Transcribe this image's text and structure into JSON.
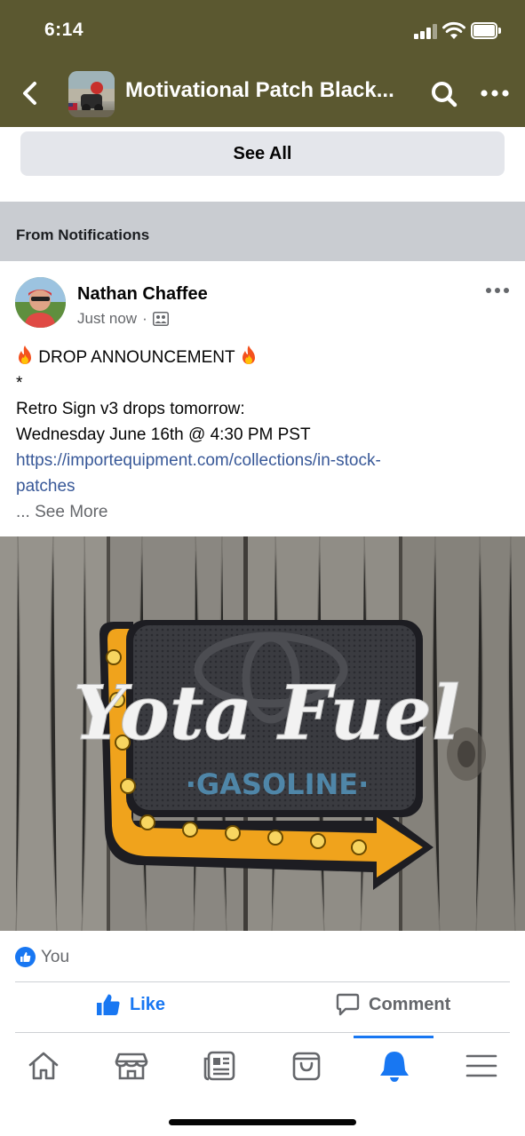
{
  "status_bar": {
    "time": "6:14"
  },
  "header": {
    "title": "Motivational Patch Black...",
    "back_icon": "chevron-left-icon",
    "search_icon": "search-icon",
    "more_icon": "more-horizontal-icon"
  },
  "see_all": {
    "label": "See All"
  },
  "section": {
    "label": "From Notifications"
  },
  "post": {
    "author": "Nathan Chaffee",
    "time": "Just now",
    "separator": "·",
    "audience_icon": "group-members-icon",
    "lines": {
      "headline": "DROP ANNOUNCEMENT",
      "asterisk": "*",
      "line1": "Retro Sign v3 drops tomorrow:",
      "line2": "Wednesday June 16th @ 4:30 PM PST",
      "link_part1": "https://importequipment.com/collections/in-stock-",
      "link_part2": "patches",
      "see_more": "... See More"
    },
    "image": {
      "patch_script": "Yota Fuel",
      "patch_sub": "·GASOLINE·"
    },
    "reactions": {
      "label": "You"
    },
    "actions": {
      "like": "Like",
      "comment": "Comment"
    }
  },
  "tabbar": {
    "items": [
      "home-icon",
      "marketplace-icon",
      "news-icon",
      "shop-icon",
      "notifications-icon",
      "menu-icon"
    ],
    "active": "notifications-icon"
  },
  "colors": {
    "header_bg": "#5b5830",
    "accent": "#1877f2",
    "link": "#385898",
    "section_bg": "#c9ccd1"
  }
}
